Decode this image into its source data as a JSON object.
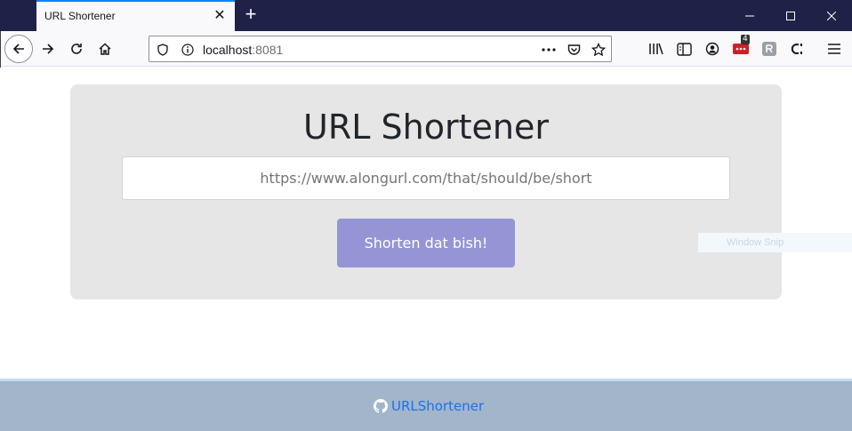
{
  "browser": {
    "tab": {
      "title": "URL Shortener",
      "close_glyph": "✕"
    },
    "new_tab_glyph": "+",
    "window_controls": {
      "minimize": "minimize-icon",
      "maximize": "maximize-icon",
      "close": "close-icon"
    },
    "address_bar": {
      "host": "localhost",
      "port": ":8081"
    },
    "toolbar": {
      "extension_badge": "4"
    }
  },
  "page": {
    "heading": "URL Shortener",
    "url_input": {
      "placeholder": "https://www.alongurl.com/that/should/be/short",
      "value": ""
    },
    "submit_button": "Shorten dat bish!",
    "ghost_label": "Window Snip",
    "footer": {
      "link_text": "URLShortener",
      "icon": "github-icon"
    }
  },
  "colors": {
    "titlebar": "#1f2246",
    "card": "#e6e6e6",
    "button": "#9595d5",
    "footer": "#a3b5cb",
    "link": "#1a73e8"
  }
}
